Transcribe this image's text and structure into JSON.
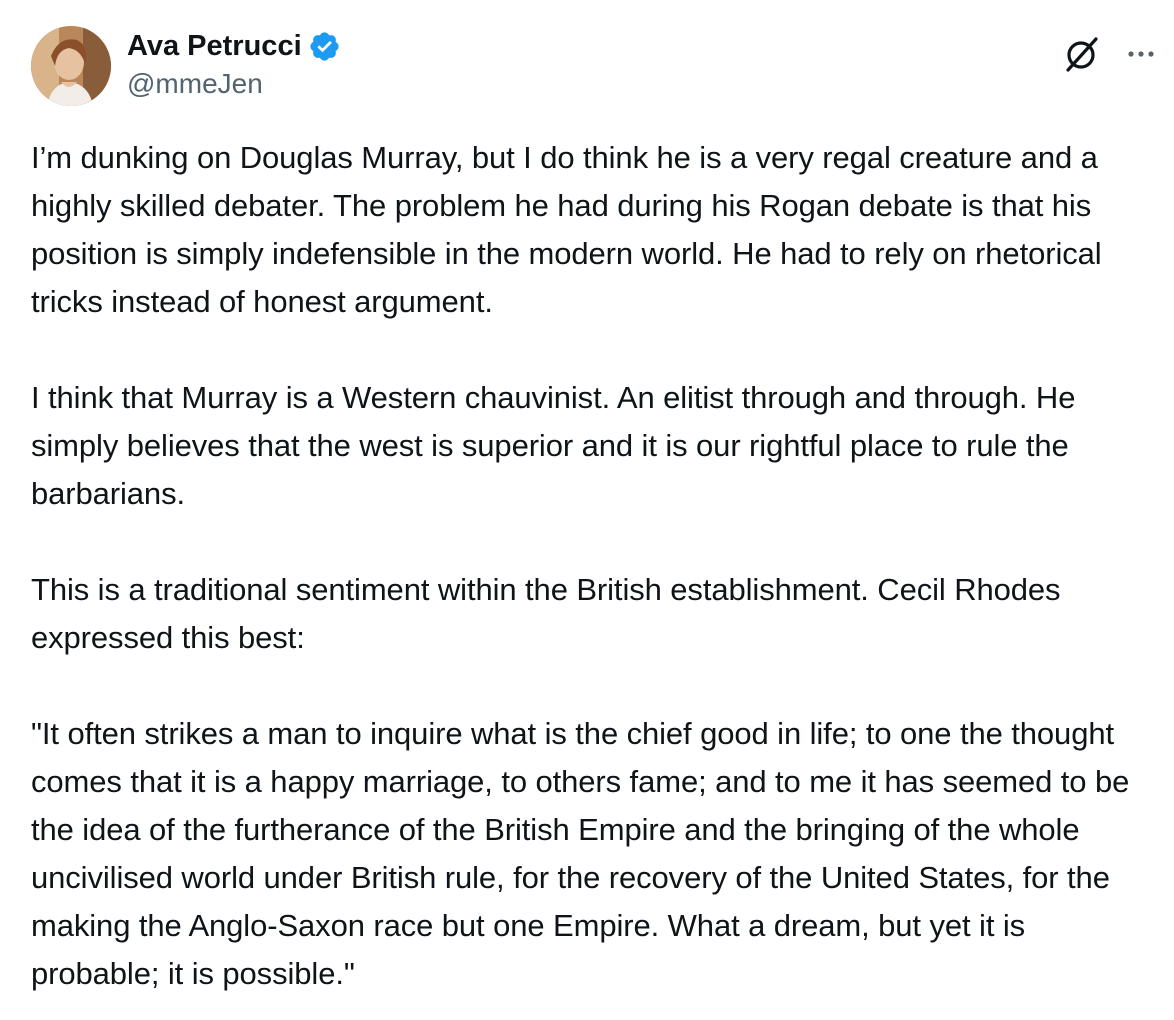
{
  "author": {
    "display_name": "Ava Petrucci",
    "handle": "@mmeJen",
    "verified": true,
    "avatar_icon": "profile-photo",
    "verified_color": "#1d9bf0"
  },
  "actions": {
    "grok_icon": "grok-slash-circle-icon",
    "more_icon": "more-horizontal-icon"
  },
  "tweet": {
    "paragraphs": [
      "I’m dunking on Douglas Murray, but I do think he is a very regal creature and a highly skilled debater. The problem he had during his Rogan debate is that his position is simply indefensible in the modern world. He had to rely on rhetorical tricks instead of honest argument.",
      "I think that Murray is a Western chauvinist. An elitist through and through. He simply believes that the west is superior and it is our rightful place to rule the barbarians.",
      "This is a traditional sentiment within the British establishment. Cecil Rhodes expressed this best:",
      "\"It often strikes a man to inquire what is the chief good in life; to one the thought comes that it is a happy marriage, to others fame; and to me it has seemed to be the idea of the furtherance of the British Empire and the bringing of the whole uncivilised world under British rule, for the recovery of the United States, for the making the Anglo-Saxon race but one Empire. What a dream, but yet it is probable; it is possible.\""
    ]
  },
  "colors": {
    "text_primary": "#0f1419",
    "text_secondary": "#536471",
    "background": "#ffffff"
  }
}
